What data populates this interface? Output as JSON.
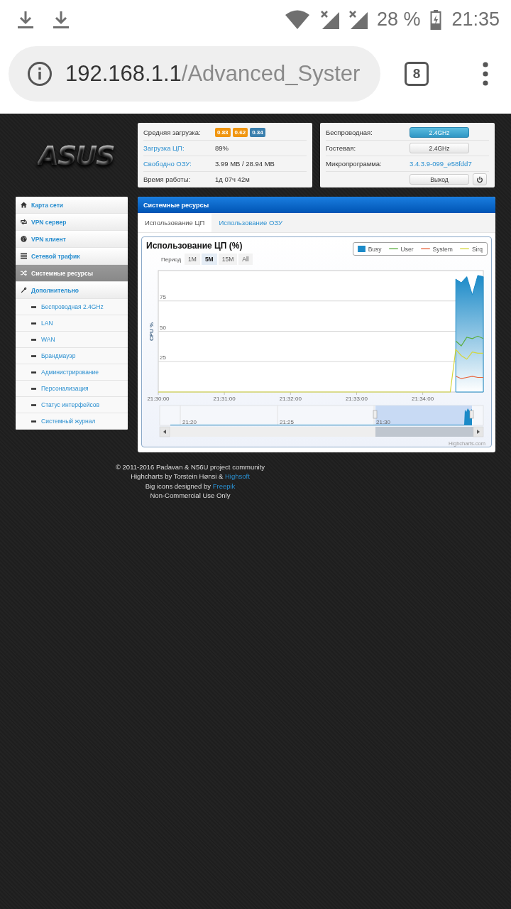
{
  "status_bar": {
    "battery": "28 %",
    "time": "21:35"
  },
  "browser": {
    "host": "192.168.1.1",
    "path": "/Advanced_Syster",
    "tab_count": "8"
  },
  "logo": "ASUS",
  "system_panel": {
    "rows": [
      {
        "label": "Средняя загрузка:",
        "link": false,
        "badges": [
          {
            "text": "0.83",
            "color": "#f0950f"
          },
          {
            "text": "0.62",
            "color": "#f0950f"
          },
          {
            "text": "0.34",
            "color": "#3a7fad"
          }
        ]
      },
      {
        "label": "Загрузка ЦП:",
        "link": true,
        "value": "89%"
      },
      {
        "label": "Свободно ОЗУ:",
        "link": true,
        "value": "3.99 MB / 28.94 MB"
      },
      {
        "label": "Время работы:",
        "link": false,
        "value": "1д 07ч 42м"
      }
    ]
  },
  "network_panel": {
    "wireless": {
      "label": "Беспроводная:",
      "button": "2.4GHz",
      "on": true
    },
    "guest": {
      "label": "Гостевая:",
      "button": "2.4GHz",
      "on": false
    },
    "firmware": {
      "label": "Микропрограмма:",
      "value": "3.4.3.9-099_e58fdd7"
    },
    "logout": "Выход"
  },
  "sidebar": {
    "items": [
      {
        "label": "Карта сети",
        "kind": "section",
        "selected": false
      },
      {
        "label": "VPN сервер",
        "kind": "section",
        "selected": false
      },
      {
        "label": "VPN клиент",
        "kind": "section",
        "selected": false
      },
      {
        "label": "Сетевой трафик",
        "kind": "section",
        "selected": false
      },
      {
        "label": "Системные ресурсы",
        "kind": "section",
        "selected": true
      },
      {
        "label": "Дополнительно",
        "kind": "section",
        "selected": false
      },
      {
        "label": "Беспроводная 2.4GHz",
        "kind": "sub",
        "selected": false
      },
      {
        "label": "LAN",
        "kind": "sub",
        "selected": false
      },
      {
        "label": "WAN",
        "kind": "sub",
        "selected": false
      },
      {
        "label": "Брандмауэр",
        "kind": "sub",
        "selected": false
      },
      {
        "label": "Администрирование",
        "kind": "sub",
        "selected": false
      },
      {
        "label": "Персонализация",
        "kind": "sub",
        "selected": false
      },
      {
        "label": "Статус интерфейсов",
        "kind": "sub",
        "selected": false
      },
      {
        "label": "Системный журнал",
        "kind": "sub",
        "selected": false
      }
    ]
  },
  "main": {
    "title": "Системные ресурсы",
    "tabs": [
      {
        "label": "Использование ЦП",
        "selected": true
      },
      {
        "label": "Использование ОЗУ",
        "selected": false
      }
    ],
    "chart_title": "Использование ЦП (%)",
    "period": {
      "label": "Период",
      "options": [
        {
          "label": "1M",
          "selected": false
        },
        {
          "label": "5M",
          "selected": true
        },
        {
          "label": "15M",
          "selected": false
        },
        {
          "label": "All",
          "selected": false
        }
      ]
    },
    "chart_data": {
      "type": "line",
      "ylabel": "CPU %",
      "grid": true,
      "categories": [
        "21:30:00",
        null,
        null,
        null,
        null,
        null,
        null,
        null,
        null,
        null,
        null,
        null,
        "21:31:00",
        null,
        null,
        null,
        null,
        null,
        null,
        null,
        null,
        null,
        null,
        null,
        "21:32:00",
        null,
        null,
        null,
        null,
        null,
        null,
        null,
        null,
        null,
        null,
        null,
        "21:33:00",
        null,
        null,
        null,
        null,
        null,
        null,
        null,
        null,
        null,
        null,
        null,
        "21:34:00",
        null,
        null,
        null,
        null,
        null,
        null,
        null,
        null,
        null,
        null,
        null
      ],
      "ylim": [
        0,
        100
      ],
      "yticks": [
        25,
        50,
        75
      ],
      "series": [
        {
          "name": "Busy",
          "type": "area",
          "color": "#1b8ac8",
          "values": [
            null,
            null,
            null,
            null,
            null,
            null,
            null,
            null,
            null,
            null,
            null,
            null,
            null,
            null,
            null,
            null,
            null,
            null,
            null,
            null,
            null,
            null,
            null,
            null,
            null,
            null,
            null,
            null,
            null,
            null,
            null,
            null,
            null,
            null,
            null,
            null,
            null,
            null,
            null,
            null,
            null,
            null,
            null,
            null,
            null,
            null,
            null,
            null,
            null,
            null,
            null,
            null,
            null,
            null,
            93,
            90,
            95,
            80,
            96,
            95
          ]
        },
        {
          "name": "User",
          "color": "#5aad3e",
          "values": [
            null,
            null,
            null,
            null,
            null,
            null,
            null,
            null,
            null,
            null,
            null,
            null,
            null,
            null,
            null,
            null,
            null,
            null,
            null,
            null,
            null,
            null,
            null,
            null,
            null,
            null,
            null,
            null,
            null,
            null,
            null,
            null,
            null,
            null,
            null,
            null,
            null,
            null,
            null,
            null,
            null,
            null,
            null,
            null,
            null,
            null,
            null,
            null,
            null,
            null,
            null,
            null,
            null,
            null,
            42,
            38,
            45,
            44,
            46,
            44
          ]
        },
        {
          "name": "System",
          "color": "#e8643c",
          "values": [
            null,
            null,
            null,
            null,
            null,
            null,
            null,
            null,
            null,
            null,
            null,
            null,
            null,
            null,
            null,
            null,
            null,
            null,
            null,
            null,
            null,
            null,
            null,
            null,
            null,
            null,
            null,
            null,
            null,
            null,
            null,
            null,
            null,
            null,
            null,
            null,
            null,
            null,
            null,
            null,
            null,
            null,
            null,
            null,
            null,
            null,
            null,
            null,
            null,
            null,
            null,
            null,
            null,
            null,
            13,
            11,
            12,
            13,
            12,
            12
          ]
        },
        {
          "name": "Sirq",
          "color": "#d4d63a",
          "values": [
            0,
            0,
            0,
            0,
            0,
            0,
            0,
            0,
            0,
            0,
            0,
            0,
            0,
            0,
            0,
            0,
            0,
            0,
            0,
            0,
            0,
            0,
            0,
            0,
            0,
            0,
            0,
            0,
            0,
            0,
            0,
            0,
            0,
            0,
            0,
            0,
            0,
            0,
            0,
            0,
            0,
            0,
            0,
            0,
            0,
            0,
            0,
            0,
            0,
            0,
            0,
            0,
            0,
            0,
            35,
            30,
            27,
            33,
            32,
            32
          ]
        }
      ]
    },
    "navigator_labels": [
      "21:20",
      "21:25",
      "21:30"
    ],
    "credit": "Highcharts.com"
  },
  "footer": [
    {
      "text": "© 2011-2016 Padavan & N56U project community"
    },
    {
      "text": "Highcharts by Torstein Hønsi & ",
      "link": "Highsoft"
    },
    {
      "text": "Big icons designed by ",
      "link": "Freepik"
    },
    {
      "text": "Non-Commercial Use Only"
    }
  ]
}
